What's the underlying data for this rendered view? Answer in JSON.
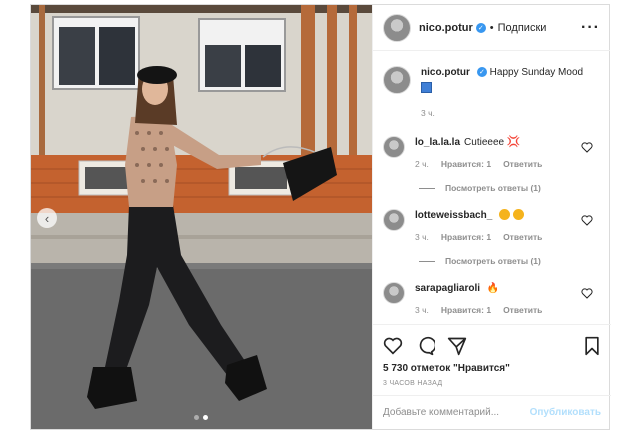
{
  "header": {
    "username": "nico.potur",
    "separator": "•",
    "follow_label": "Подписки",
    "more_icon": "more-dots-icon"
  },
  "caption": {
    "username": "nico.potur",
    "text": "Happy Sunday Mood",
    "time": "3 ч."
  },
  "comments": [
    {
      "username": "lo_la.la.la",
      "text": "Cutieeee",
      "time": "2 ч.",
      "likes": "Нравится: 1",
      "reply": "Ответить",
      "replies": "Посмотреть ответы (1)"
    },
    {
      "username": "lotteweissbach_",
      "text": "",
      "time": "3 ч.",
      "likes": "Нравится: 1",
      "reply": "Ответить",
      "replies": "Посмотреть ответы (1)"
    },
    {
      "username": "sarapagliaroli",
      "text": "",
      "time": "3 ч.",
      "likes": "Нравится: 1",
      "reply": "Ответить"
    }
  ],
  "stats": {
    "likes": "5 730 отметок \"Нравится\"",
    "posted": "3 ЧАСОВ НАЗАД"
  },
  "composer": {
    "placeholder": "Добавьте комментарий...",
    "publish": "Опубликовать"
  },
  "colors": {
    "verified": "#3897f0",
    "publish_disabled": "#b2dffc",
    "muted": "#8e8e8e"
  },
  "carousel": {
    "current": 2,
    "total": 2
  }
}
